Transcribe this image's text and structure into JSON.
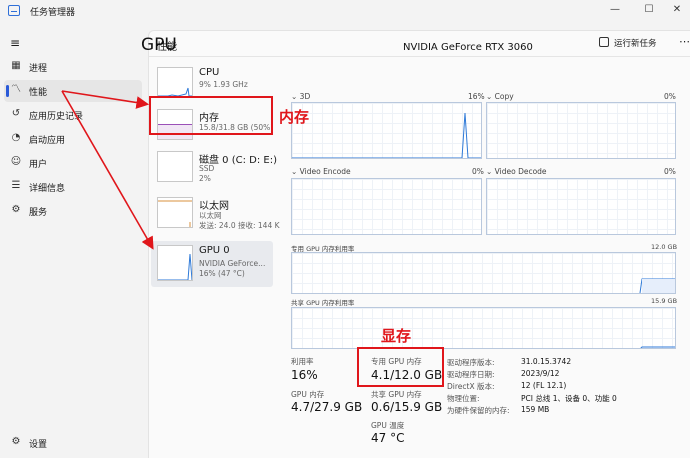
{
  "window": {
    "title": "任务管理器",
    "minimize": "—",
    "maximize": "☐",
    "close": "✕"
  },
  "nav": {
    "menu_icon": "hamburger-icon",
    "items": [
      {
        "label": "进程",
        "icon": "processes-icon"
      },
      {
        "label": "性能",
        "icon": "performance-icon",
        "active": true
      },
      {
        "label": "应用历史记录",
        "icon": "history-icon"
      },
      {
        "label": "启动应用",
        "icon": "startup-icon"
      },
      {
        "label": "用户",
        "icon": "users-icon"
      },
      {
        "label": "详细信息",
        "icon": "details-icon"
      },
      {
        "label": "服务",
        "icon": "services-icon"
      }
    ],
    "settings": {
      "label": "设置",
      "icon": "gear-icon"
    }
  },
  "header": {
    "title": "性能",
    "run_task": "运行新任务",
    "more": "⋯"
  },
  "devices": [
    {
      "name": "CPU",
      "sub1": "9% 1.93 GHz"
    },
    {
      "name": "内存",
      "sub1": "15.8/31.8 GB (50%)"
    },
    {
      "name": "磁盘 0 (C: D: E:)",
      "sub1": "SSD",
      "sub2": "2%"
    },
    {
      "name": "以太网",
      "sub1": "以太网",
      "sub2": "发送: 24.0  接收: 144 K"
    },
    {
      "name": "GPU 0",
      "sub1": "NVIDIA GeForce...",
      "sub2": "16% (47 °C)"
    }
  ],
  "gpu": {
    "title": "GPU",
    "model": "NVIDIA GeForce RTX 3060",
    "engines": [
      {
        "name": "3D",
        "pct": "16%"
      },
      {
        "name": "Copy",
        "pct": "0%"
      },
      {
        "name": "Video Encode",
        "pct": "0%"
      },
      {
        "name": "Video Decode",
        "pct": "0%"
      }
    ],
    "dedicated_graph": {
      "label": "专用 GPU 内存利用率",
      "max": "12.0 GB"
    },
    "shared_graph": {
      "label": "共享 GPU 内存利用率",
      "max": "15.9 GB"
    },
    "stats": {
      "utilization": {
        "label": "利用率",
        "value": "16%"
      },
      "dedicated_mem": {
        "label": "专用 GPU 内存",
        "value": "4.1/12.0 GB"
      },
      "gpu_mem": {
        "label": "GPU 内存",
        "value": "4.7/27.9 GB"
      },
      "shared_mem": {
        "label": "共享 GPU 内存",
        "value": "0.6/15.9 GB"
      },
      "temp": {
        "label": "GPU 温度",
        "value": "47 °C"
      }
    },
    "info": [
      {
        "k": "驱动程序版本:",
        "v": "31.0.15.3742"
      },
      {
        "k": "驱动程序日期:",
        "v": "2023/9/12"
      },
      {
        "k": "DirectX 版本:",
        "v": "12 (FL 12.1)"
      },
      {
        "k": "物理位置:",
        "v": "PCI 总线 1、设备 0、功能 0"
      },
      {
        "k": "为硬件保留的内存:",
        "v": "159 MB"
      }
    ]
  },
  "annotations": {
    "memory": "内存",
    "vram": "显存",
    "color": "#e0161b"
  }
}
